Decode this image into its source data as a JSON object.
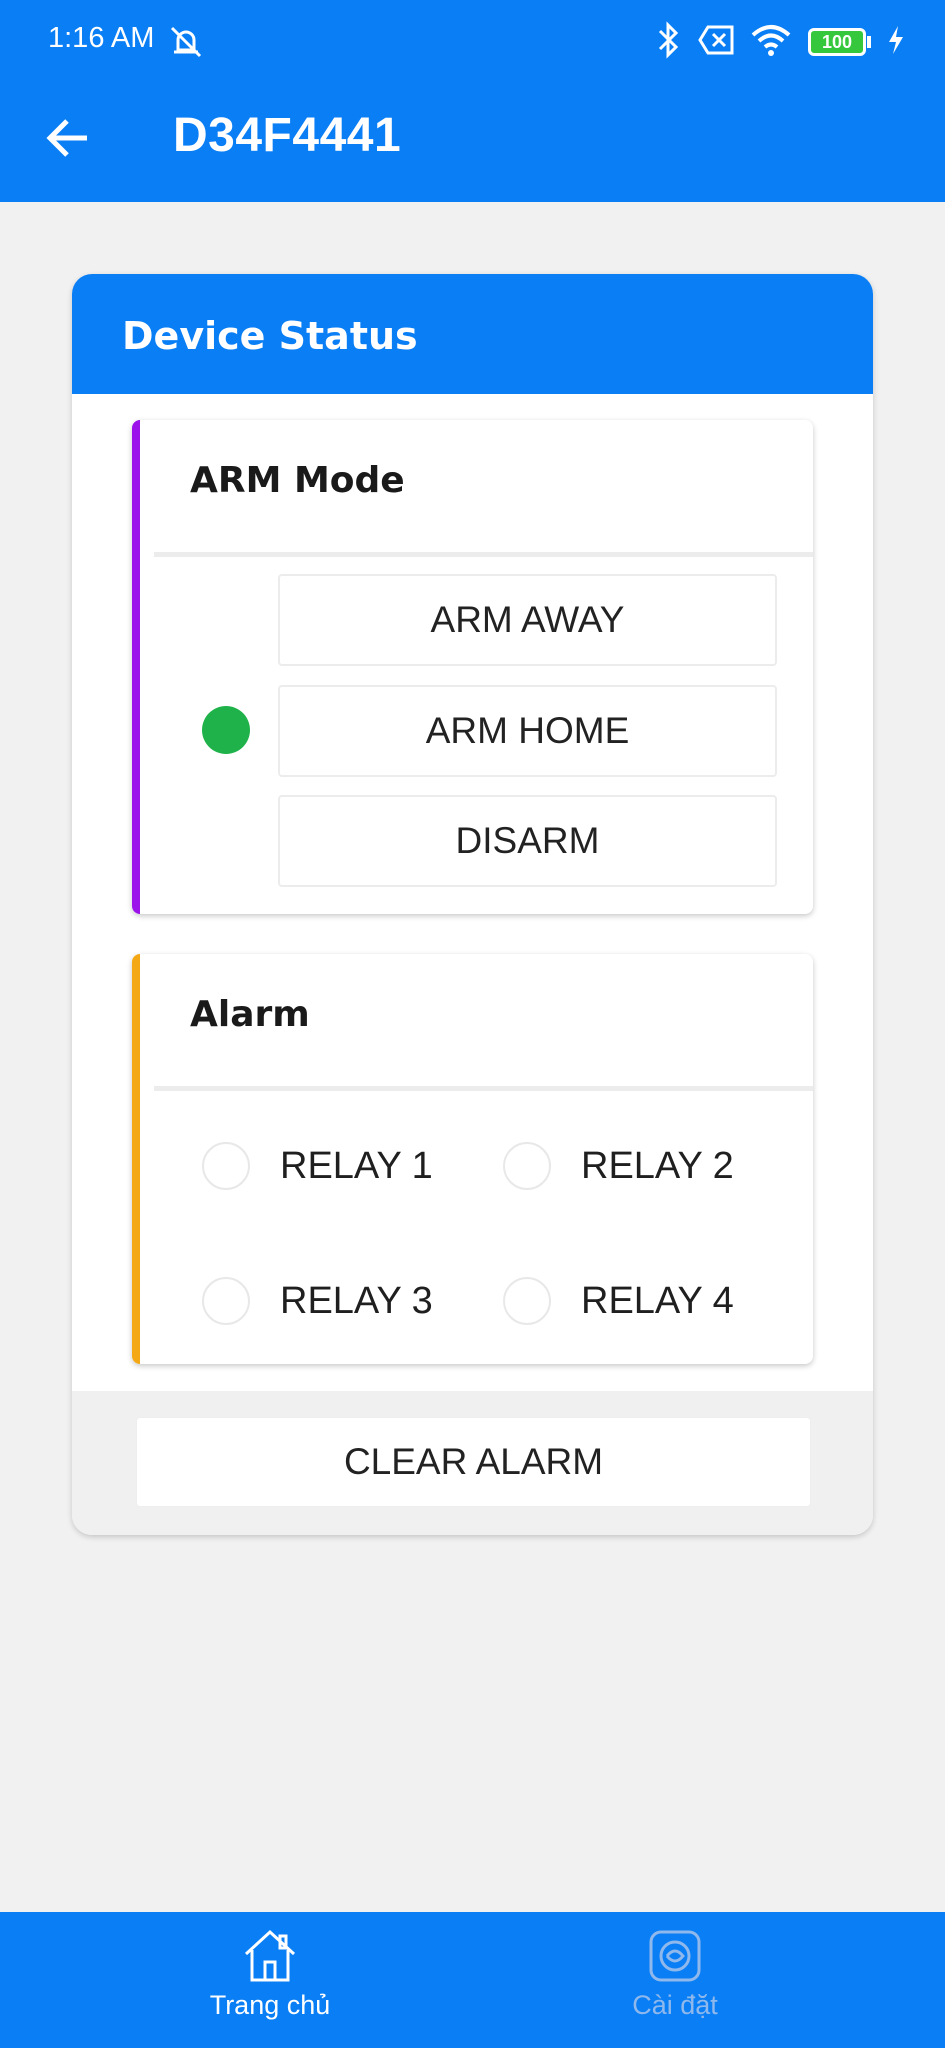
{
  "status_bar": {
    "time": "1:16 AM",
    "battery": "100"
  },
  "app_bar": {
    "title": "D34F4441",
    "back_icon": "arrow-left-icon"
  },
  "card": {
    "title": "Device Status",
    "arm_mode": {
      "title": "ARM Mode",
      "accent_color": "#9b12ea",
      "options": [
        {
          "label": "ARM AWAY",
          "selected": false
        },
        {
          "label": "ARM HOME",
          "selected": true
        },
        {
          "label": "DISARM",
          "selected": false
        }
      ],
      "selected_indicator_color": "#20b24a"
    },
    "alarm": {
      "title": "Alarm",
      "accent_color": "#f5a816",
      "relays": [
        {
          "label": "RELAY 1",
          "checked": false
        },
        {
          "label": "RELAY 2",
          "checked": false
        },
        {
          "label": "RELAY 3",
          "checked": false
        },
        {
          "label": "RELAY 4",
          "checked": false
        }
      ]
    },
    "clear_alarm_label": "CLEAR ALARM"
  },
  "bottom_nav": {
    "items": [
      {
        "label": "Trang chủ",
        "icon": "home-icon",
        "active": true
      },
      {
        "label": "Cài đặt",
        "icon": "settings-icon",
        "active": false
      }
    ]
  },
  "colors": {
    "primary": "#0a7ef5",
    "background": "#f1f1f1"
  }
}
